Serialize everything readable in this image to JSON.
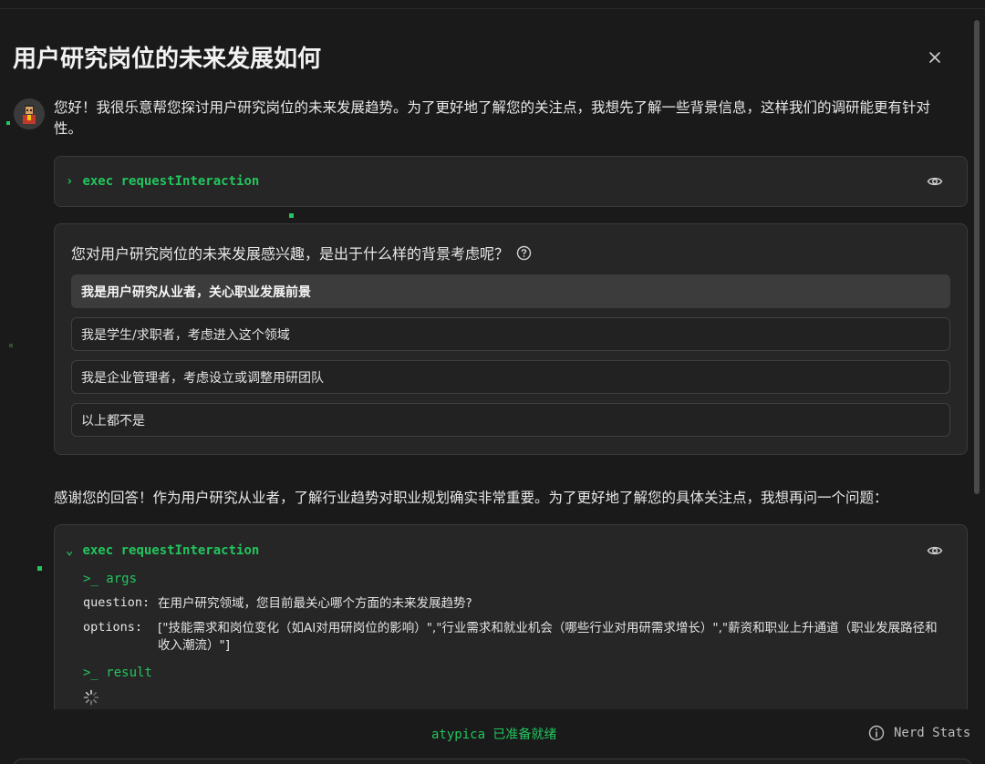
{
  "dialog": {
    "title": "用户研究岗位的未来发展如何",
    "close_icon": "close-icon"
  },
  "messages": {
    "first": "您好！我很乐意帮您探讨用户研究岗位的未来发展趋势。为了更好地了解您的关注点，我想先了解一些背景信息，这样我们的调研能更有针对性。",
    "second": "感谢您的回答！作为用户研究从业者，了解行业趋势对职业规划确实非常重要。为了更好地了解您的具体关注点，我想再问一个问题："
  },
  "exec1": {
    "chevron": "›",
    "label": "exec requestInteraction"
  },
  "question_card": {
    "question": "您对用户研究岗位的未来发展感兴趣，是出于什么样的背景考虑呢？",
    "options": [
      "我是用户研究从业者，关心职业发展前景",
      "我是学生/求职者，考虑进入这个领域",
      "我是企业管理者，考虑设立或调整用研团队",
      "以上都不是"
    ],
    "selected_index": 0
  },
  "exec2": {
    "chevron": "⌄",
    "label": "exec requestInteraction",
    "args_heading": ">_ args",
    "question_key": "question:",
    "question_value": "在用户研究领域，您目前最关心哪个方面的未来发展趋势?",
    "options_key": "options:",
    "options_value": "[\"技能需求和岗位变化（如AI对用研岗位的影响）\",\"行业需求和就业机会（哪些行业对用研需求增长）\",\"薪资和职业上升通道（职业发展路径和收入潮流）\"]",
    "result_heading": ">_ result"
  },
  "footer": {
    "status": "atypica 已准备就绪",
    "nerd_stats": "Nerd Stats"
  },
  "colors": {
    "accent": "#22c55e",
    "background": "#1a1a1a",
    "card": "#262626"
  }
}
